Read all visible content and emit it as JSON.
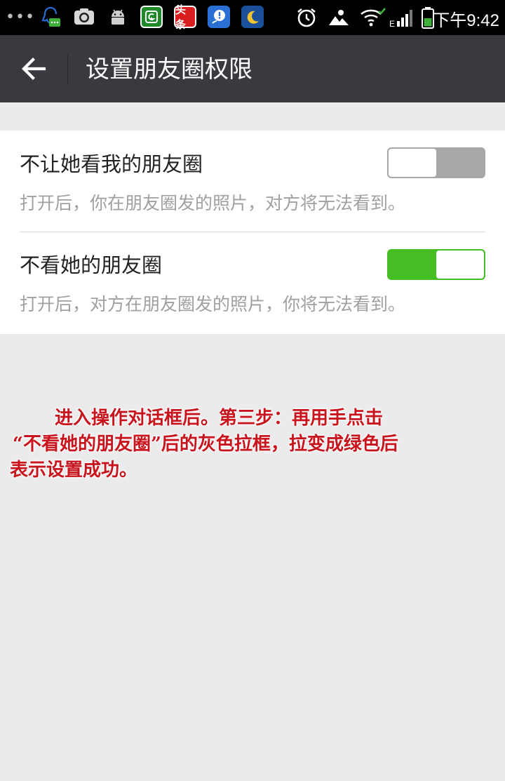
{
  "status_bar": {
    "time": "下午9:42",
    "network_type": "E",
    "app_icons": [
      "qq-icon",
      "screenshot-icon",
      "android-icon",
      "security-icon",
      "toutiao-icon",
      "chat-icon",
      "night-mode-icon"
    ],
    "toutiao_label": "头条",
    "right_icons": [
      "alarm-icon",
      "sync-icon",
      "wifi-icon",
      "signal-icon",
      "battery-icon"
    ]
  },
  "header": {
    "title": "设置朋友圈权限"
  },
  "settings": [
    {
      "title": "不让她看我的朋友圈",
      "description": "打开后，你在朋友圈发的照片，对方将无法看到。",
      "enabled": false
    },
    {
      "title": "不看她的朋友圈",
      "description": "打开后，对方在朋友圈发的照片，你将无法看到。",
      "enabled": true
    }
  ],
  "annotation": {
    "line1": "进入操作对话框后。第三步：再用手点击",
    "line2": "“不看她的朋友圈”后的灰色拉框，拉变成绿色后",
    "line3": "表示设置成功。"
  },
  "colors": {
    "header_bg": "#393a3f",
    "page_bg": "#ebebeb",
    "toggle_on": "#44be23",
    "toggle_off": "#a8a8a8",
    "annotation_text": "#c8141c"
  }
}
